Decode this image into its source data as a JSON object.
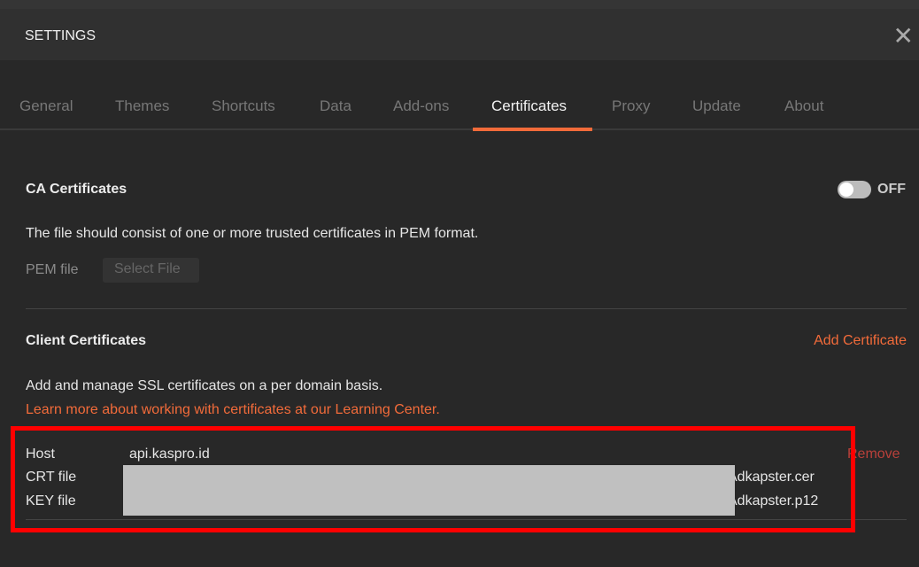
{
  "header": {
    "title": "SETTINGS",
    "close_icon": "close-icon"
  },
  "tabs": [
    "General",
    "Themes",
    "Shortcuts",
    "Data",
    "Add-ons",
    "Certificates",
    "Proxy",
    "Update",
    "About"
  ],
  "active_tab": "Certificates",
  "ca": {
    "title": "CA Certificates",
    "toggle_label": "OFF",
    "toggle_on": false,
    "description": "The file should consist of one or more trusted certificates in PEM format.",
    "pem_label": "PEM file",
    "select_file": "Select File"
  },
  "client": {
    "title": "Client Certificates",
    "add": "Add Certificate",
    "description": "Add and manage SSL certificates on a per domain basis.",
    "learn_more": "Learn more about working with certificates at our Learning Center.",
    "entry": {
      "host_label": "Host",
      "host": "api.kaspro.id",
      "crt_label": "CRT file",
      "crt": "Adkapster.cer",
      "key_label": "KEY file",
      "key": "Adkapster.p12",
      "remove": "Remove"
    }
  },
  "colors": {
    "accent": "#f26b3a",
    "highlight": "#ff0000"
  }
}
